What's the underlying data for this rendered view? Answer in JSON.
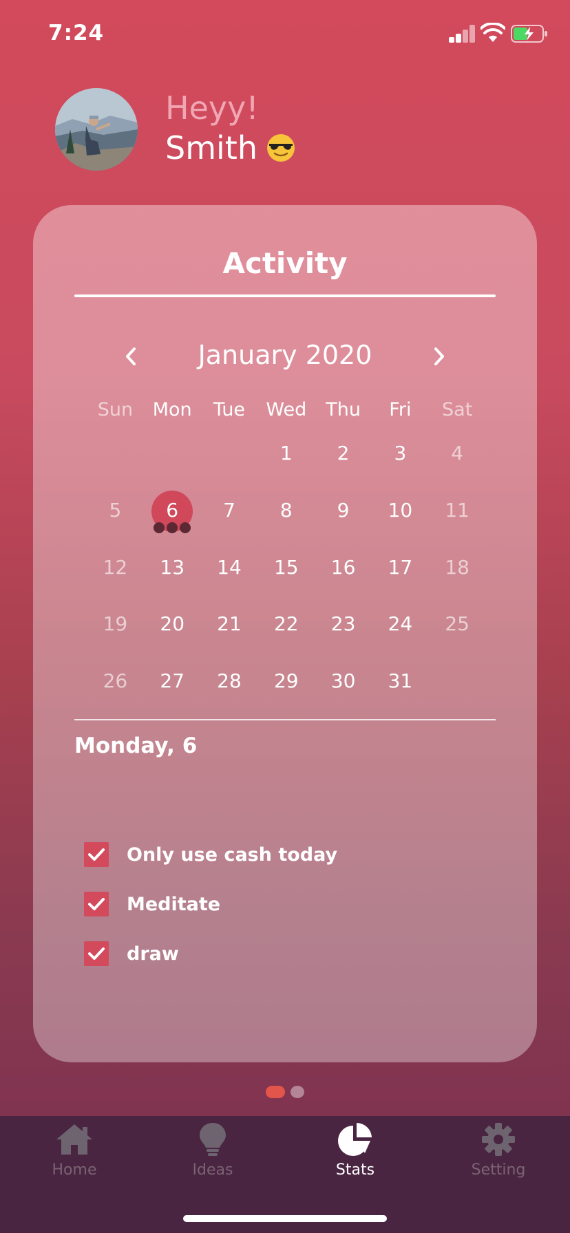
{
  "status_bar": {
    "time": "7:24"
  },
  "header": {
    "greeting": "Heyy!",
    "name": "Smith",
    "emoji": "😎"
  },
  "card": {
    "title": "Activity",
    "calendar": {
      "month_label": "January 2020",
      "weekdays": [
        "Sun",
        "Mon",
        "Tue",
        "Wed",
        "Thu",
        "Fri",
        "Sat"
      ],
      "weeks": [
        [
          "",
          "",
          "",
          "1",
          "2",
          "3",
          "4"
        ],
        [
          "5",
          "6",
          "7",
          "8",
          "9",
          "10",
          "11"
        ],
        [
          "12",
          "13",
          "14",
          "15",
          "16",
          "17",
          "18"
        ],
        [
          "19",
          "20",
          "21",
          "22",
          "23",
          "24",
          "25"
        ],
        [
          "26",
          "27",
          "28",
          "29",
          "30",
          "31",
          ""
        ]
      ],
      "selected_day": "6"
    },
    "selected_day_label": "Monday, 6",
    "tasks": [
      {
        "label": "Only use cash today",
        "checked": true
      },
      {
        "label": "Meditate",
        "checked": true
      },
      {
        "label": "draw",
        "checked": true
      }
    ]
  },
  "pager": {
    "pages": 2,
    "active": 1
  },
  "tab_bar": {
    "tabs": [
      {
        "label": "Home",
        "icon": "home-icon",
        "active": false
      },
      {
        "label": "Ideas",
        "icon": "lightbulb-icon",
        "active": false
      },
      {
        "label": "Stats",
        "icon": "pie-chart-icon",
        "active": true
      },
      {
        "label": "Setting",
        "icon": "gear-icon",
        "active": false
      }
    ]
  },
  "colors": {
    "accent": "#d24a5c",
    "tab_bar": "#4a2542",
    "pager_active": "#e2554a"
  }
}
